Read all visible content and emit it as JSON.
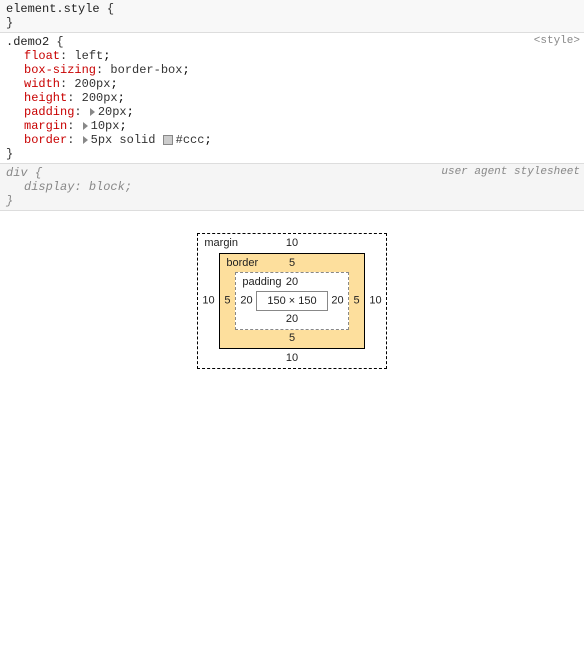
{
  "rules": {
    "element_style": {
      "selector": "element.style",
      "open": "{",
      "close": "}"
    },
    "demo2": {
      "selector": ".demo2",
      "open": "{",
      "close": "}",
      "origin": "<style>",
      "decls": {
        "float": {
          "prop": "float",
          "val": "left"
        },
        "box_sizing": {
          "prop": "box-sizing",
          "val": "border-box"
        },
        "width": {
          "prop": "width",
          "val": "200px"
        },
        "height": {
          "prop": "height",
          "val": "200px"
        },
        "padding": {
          "prop": "padding",
          "val": "20px"
        },
        "margin": {
          "prop": "margin",
          "val": "10px"
        },
        "border": {
          "prop": "border",
          "val_size": "5px solid",
          "val_color": "#ccc"
        }
      }
    },
    "div": {
      "selector": "div",
      "open": "{",
      "close": "}",
      "origin": "user agent stylesheet",
      "decls": {
        "display": {
          "prop": "display",
          "val": "block"
        }
      }
    }
  },
  "box_model": {
    "margin": {
      "label": "margin",
      "top": "10",
      "right": "10",
      "bottom": "10",
      "left": "10"
    },
    "border": {
      "label": "border",
      "top": "5",
      "right": "5",
      "bottom": "5",
      "left": "5"
    },
    "padding": {
      "label": "padding",
      "top": "20",
      "right": "20",
      "bottom": "20",
      "left": "20"
    },
    "content": "150 × 150"
  },
  "punct": {
    "semicolon": ";"
  }
}
